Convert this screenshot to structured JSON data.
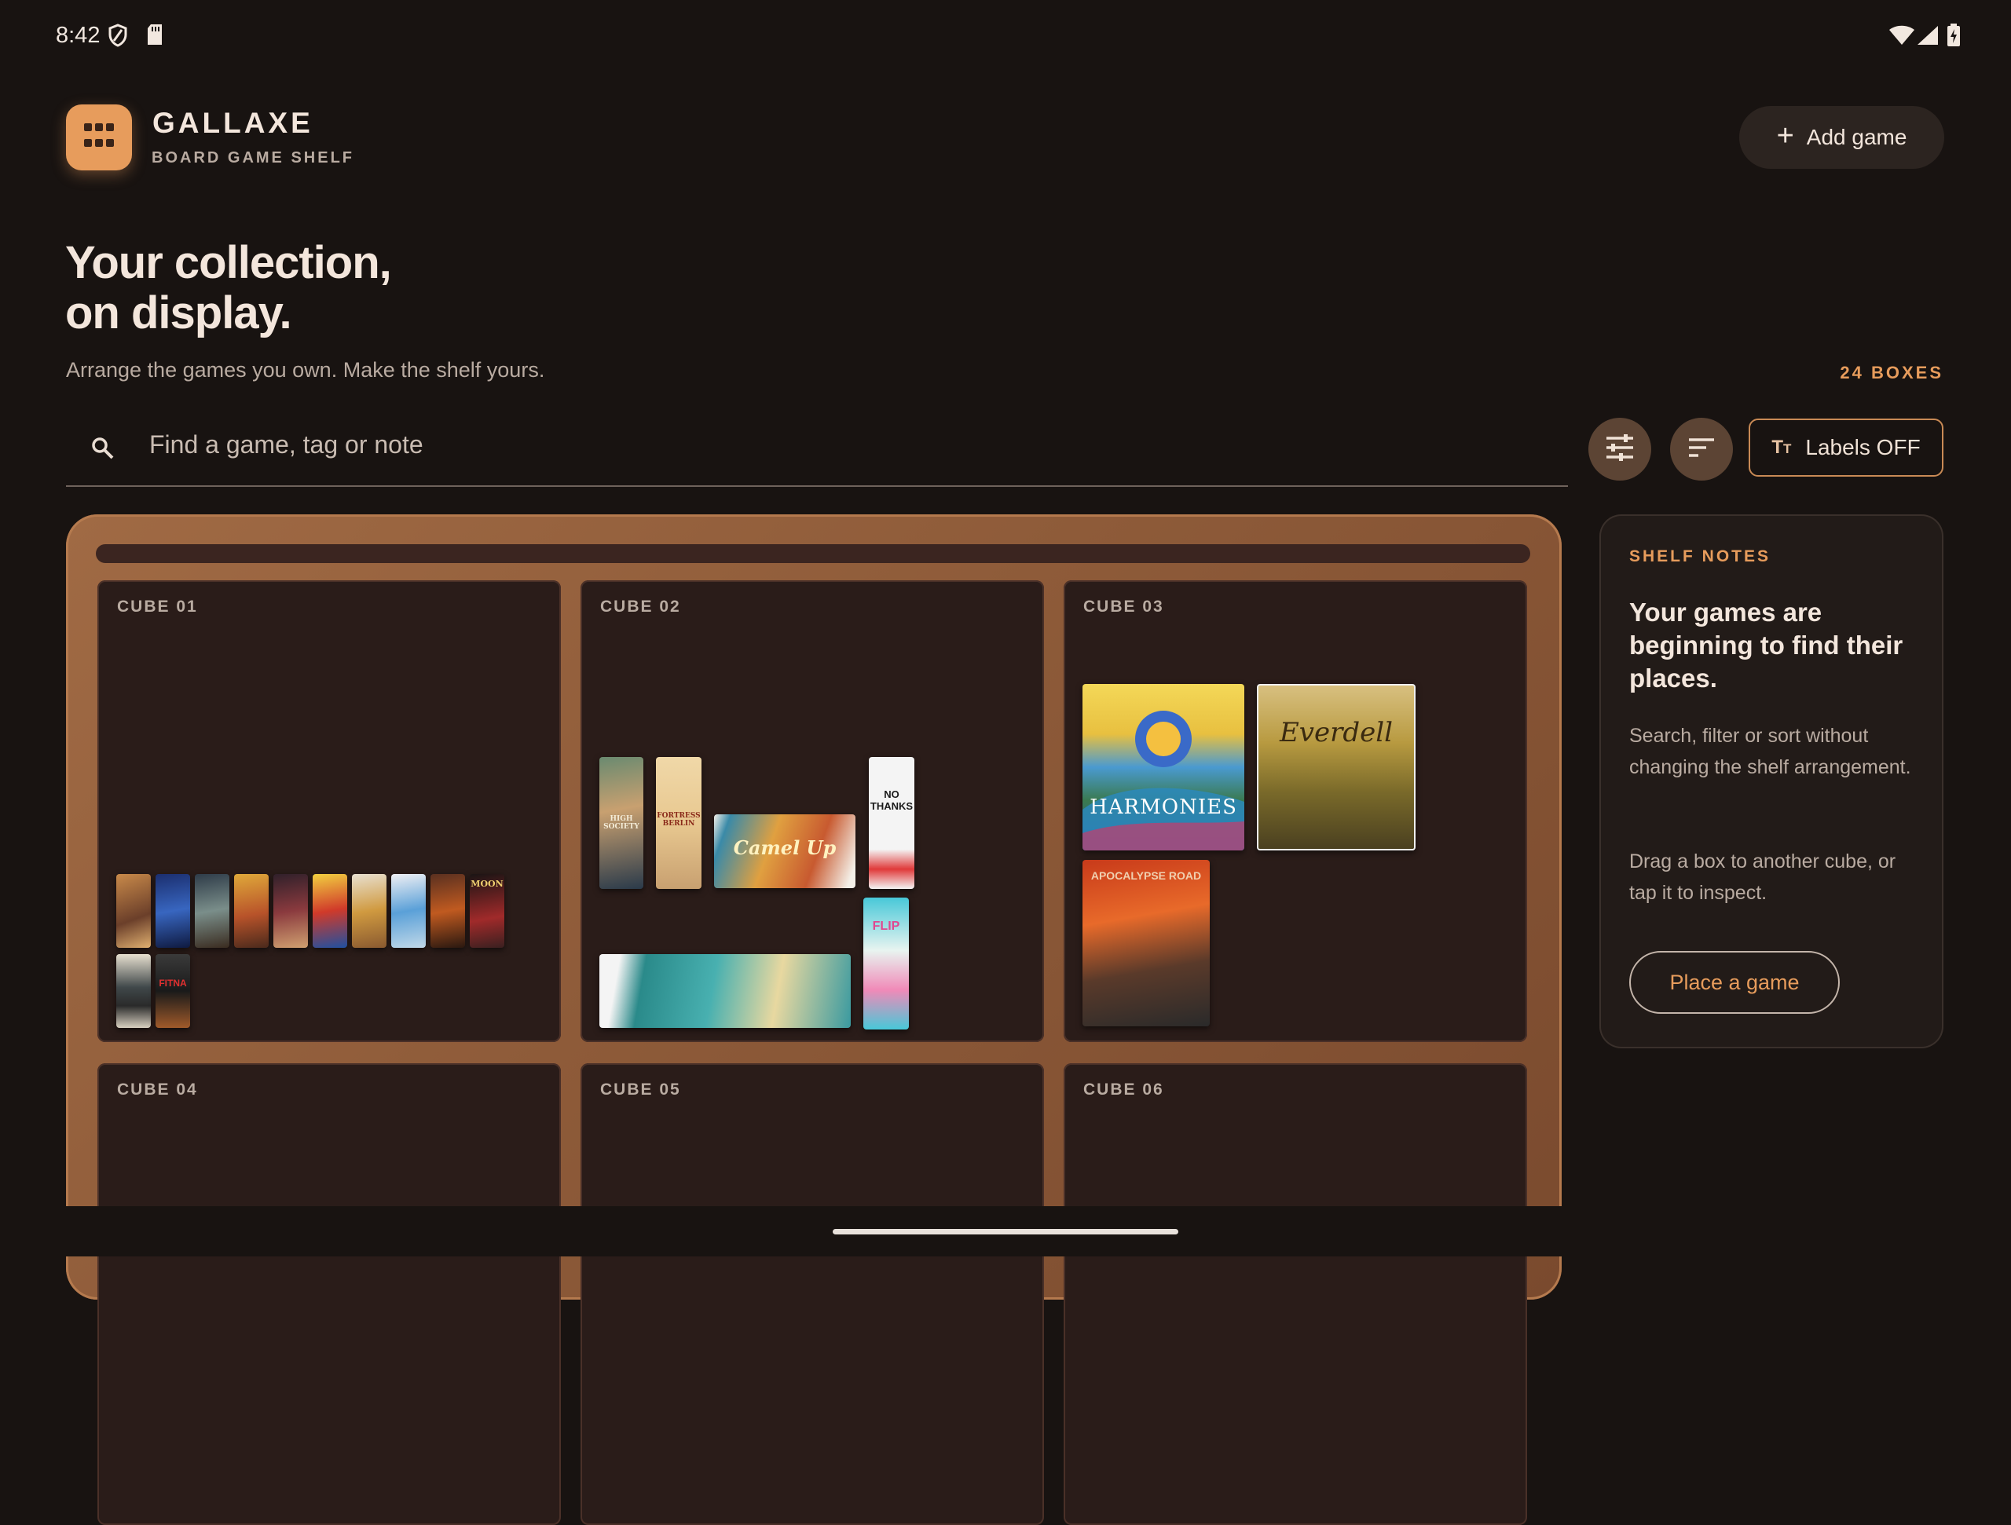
{
  "status_bar": {
    "time": "8:42",
    "left_icons": [
      "shield-icon",
      "sd-card-icon"
    ],
    "right_icons": [
      "wifi-icon",
      "signal-icon",
      "battery-charging-icon"
    ]
  },
  "header": {
    "logo_icon": "grid-icon",
    "app_name": "GALLAXE",
    "tagline": "BOARD GAME SHELF",
    "add_button": "Add game"
  },
  "hero": {
    "title_line1": "Your collection,",
    "title_line2": "on display.",
    "subtitle": "Arrange the games you own. Make the shelf yours.",
    "box_count": "24 BOXES"
  },
  "search": {
    "placeholder": "Find a game, tag or note",
    "value": ""
  },
  "toolbar": {
    "filter_icon": "tune-icon",
    "sort_icon": "sort-icon",
    "labels_toggle": "Labels OFF"
  },
  "shelf": {
    "cubes": [
      {
        "label": "CUBE 01"
      },
      {
        "label": "CUBE 02"
      },
      {
        "label": "CUBE 03"
      },
      {
        "label": "CUBE 04"
      },
      {
        "label": "CUBE 05"
      },
      {
        "label": "CUBE 06"
      }
    ],
    "cover_text": {
      "high_society": "HIGH SOCIETY",
      "fortress_berlin": "FORTRESS BERLIN",
      "camel_up": "Camel Up",
      "no_thanks": "NO THANKS",
      "flip": "FLIP",
      "harmonies": "HARMONIES",
      "everdell": "Everdell",
      "apocalypse_road": "APOCALYPSE ROAD",
      "moon": "MOON",
      "fitna": "FITNA"
    }
  },
  "notes": {
    "kicker": "SHELF NOTES",
    "heading": "Your games are beginning to find their places.",
    "para1": "Search, filter or sort without changing the shelf arrangement.",
    "para2": "Drag a box to another cube, or tap it to inspect.",
    "button": "Place a game"
  },
  "colors": {
    "background": "#181311",
    "accent": "#e79c5c",
    "shelf_wood": "#8e5b39",
    "cube_bg": "#2a1c19"
  }
}
